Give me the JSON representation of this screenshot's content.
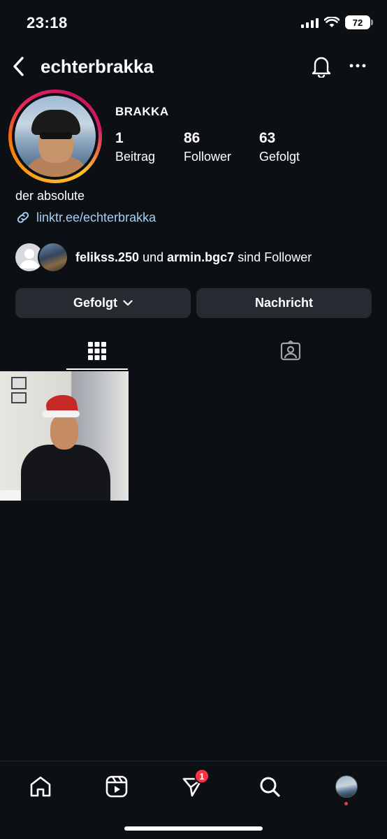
{
  "status_bar": {
    "time": "23:18",
    "battery": "72"
  },
  "header": {
    "username": "echterbrakka"
  },
  "profile": {
    "display_name": "BRAKKA",
    "stats": [
      {
        "value": "1",
        "label": "Beitrag"
      },
      {
        "value": "86",
        "label": "Follower"
      },
      {
        "value": "63",
        "label": "Gefolgt"
      }
    ],
    "bio": "der absolute",
    "link": "linktr.ee/echterbrakka"
  },
  "followed_by": {
    "user1": "felikss.250",
    "connector": "und",
    "user2": "armin.bgc7",
    "suffix": "sind Follower"
  },
  "actions": {
    "following_label": "Gefolgt",
    "message_label": "Nachricht"
  },
  "tabs": [
    {
      "icon": "grid-icon",
      "active": true
    },
    {
      "icon": "tagged-icon",
      "active": false
    }
  ],
  "bottom_nav": {
    "items": [
      "home-icon",
      "reels-icon",
      "direct-icon",
      "search-icon",
      "profile-avatar"
    ],
    "direct_badge": "1"
  },
  "colors": {
    "background": "#0c0f14",
    "button": "#262a31",
    "link": "#a8cdf5",
    "badge": "#ff3040"
  }
}
